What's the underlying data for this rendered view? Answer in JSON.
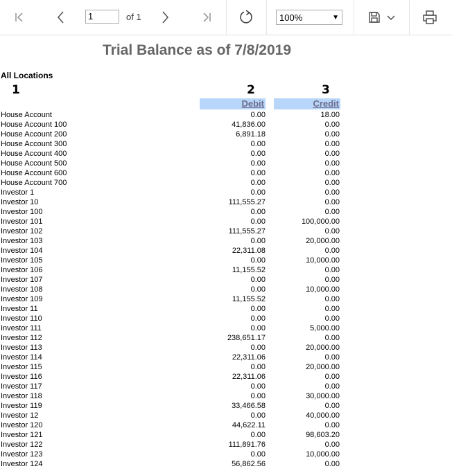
{
  "toolbar": {
    "page_value": "1",
    "of_label": "of 1",
    "zoom": "100%",
    "icons": [
      "first-page-icon",
      "previous-page-icon",
      "next-page-icon",
      "last-page-icon",
      "refresh-icon",
      "save-icon",
      "chevron-down-icon",
      "print-icon"
    ]
  },
  "report": {
    "title": "Trial Balance as of 7/8/2019",
    "location": "All Locations",
    "col_numbers": [
      "1",
      "2",
      "3"
    ],
    "headers": {
      "debit": "Debit",
      "credit": "Credit"
    },
    "header_bg": "#b8d6f9",
    "rows": [
      {
        "account": "House Account",
        "debit": "0.00",
        "credit": "18.00"
      },
      {
        "account": "House Account 100",
        "debit": "41,836.00",
        "credit": "0.00"
      },
      {
        "account": "House Account 200",
        "debit": "6,891.18",
        "credit": "0.00"
      },
      {
        "account": "House Account 300",
        "debit": "0.00",
        "credit": "0.00"
      },
      {
        "account": "House Account 400",
        "debit": "0.00",
        "credit": "0.00"
      },
      {
        "account": "House Account 500",
        "debit": "0.00",
        "credit": "0.00"
      },
      {
        "account": "House Account 600",
        "debit": "0.00",
        "credit": "0.00"
      },
      {
        "account": "House Account 700",
        "debit": "0.00",
        "credit": "0.00"
      },
      {
        "account": "Investor 1",
        "debit": "0.00",
        "credit": "0.00"
      },
      {
        "account": "Investor 10",
        "debit": "111,555.27",
        "credit": "0.00"
      },
      {
        "account": "Investor 100",
        "debit": "0.00",
        "credit": "0.00"
      },
      {
        "account": "Investor 101",
        "debit": "0.00",
        "credit": "100,000.00"
      },
      {
        "account": "Investor 102",
        "debit": "111,555.27",
        "credit": "0.00"
      },
      {
        "account": "Investor 103",
        "debit": "0.00",
        "credit": "20,000.00"
      },
      {
        "account": "Investor 104",
        "debit": "22,311.08",
        "credit": "0.00"
      },
      {
        "account": "Investor 105",
        "debit": "0.00",
        "credit": "10,000.00"
      },
      {
        "account": "Investor 106",
        "debit": "11,155.52",
        "credit": "0.00"
      },
      {
        "account": "Investor 107",
        "debit": "0.00",
        "credit": "0.00"
      },
      {
        "account": "Investor 108",
        "debit": "0.00",
        "credit": "10,000.00"
      },
      {
        "account": "Investor 109",
        "debit": "11,155.52",
        "credit": "0.00"
      },
      {
        "account": "Investor 11",
        "debit": "0.00",
        "credit": "0.00"
      },
      {
        "account": "Investor 110",
        "debit": "0.00",
        "credit": "0.00"
      },
      {
        "account": "Investor 111",
        "debit": "0.00",
        "credit": "5,000.00"
      },
      {
        "account": "Investor 112",
        "debit": "238,651.17",
        "credit": "0.00"
      },
      {
        "account": "Investor 113",
        "debit": "0.00",
        "credit": "20,000.00"
      },
      {
        "account": "Investor 114",
        "debit": "22,311.06",
        "credit": "0.00"
      },
      {
        "account": "Investor 115",
        "debit": "0.00",
        "credit": "20,000.00"
      },
      {
        "account": "Investor 116",
        "debit": "22,311.06",
        "credit": "0.00"
      },
      {
        "account": "Investor 117",
        "debit": "0.00",
        "credit": "0.00"
      },
      {
        "account": "Investor 118",
        "debit": "0.00",
        "credit": "30,000.00"
      },
      {
        "account": "Investor 119",
        "debit": "33,466.58",
        "credit": "0.00"
      },
      {
        "account": "Investor 12",
        "debit": "0.00",
        "credit": "40,000.00"
      },
      {
        "account": "Investor 120",
        "debit": "44,622.11",
        "credit": "0.00"
      },
      {
        "account": "Investor 121",
        "debit": "0.00",
        "credit": "98,603.20"
      },
      {
        "account": "Investor 122",
        "debit": "111,891.76",
        "credit": "0.00"
      },
      {
        "account": "Investor 123",
        "debit": "0.00",
        "credit": "10,000.00"
      },
      {
        "account": "Investor 124",
        "debit": "56,862.56",
        "credit": "0.00"
      }
    ]
  }
}
